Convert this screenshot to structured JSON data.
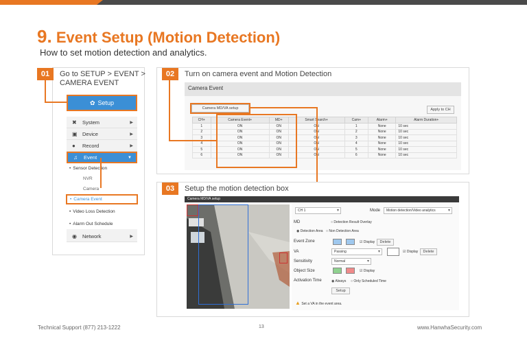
{
  "header": {
    "number": "9.",
    "title": "Event Setup (Motion Detection)",
    "subtitle": "How to set motion detection and analytics."
  },
  "steps": [
    {
      "num": "01",
      "text_line1": "Go to SETUP > EVENT >",
      "text_line2": "CAMERA EVENT"
    },
    {
      "num": "02",
      "text": "Turn on camera event and Motion Detection"
    },
    {
      "num": "03",
      "text": "Setup the motion detection box"
    }
  ],
  "menu": {
    "setup_label": "Setup",
    "items": [
      {
        "label": "System",
        "icon": "wrench-icon"
      },
      {
        "label": "Device",
        "icon": "camera-icon"
      },
      {
        "label": "Record",
        "icon": "record-icon"
      }
    ],
    "event_label": "Event",
    "sub": {
      "sensor_detection": "Sensor Detection",
      "nvr": "NVR",
      "camera": "Camera",
      "camera_event": "Camera Event",
      "video_loss": "Video Loss Detection",
      "alarm_out": "Alarm Out Schedule"
    },
    "network_label": "Network"
  },
  "camera_event": {
    "panel_title": "Camera Event",
    "setup_button": "Camera MD/VA setup",
    "apply_button": "Apply to CH",
    "columns": [
      "CH+",
      "Camera Event+",
      "MD+",
      "Smart Search+",
      "Cam+",
      "Alarm+",
      "Alarm Duration+"
    ],
    "rows": [
      [
        "1",
        "ON",
        "ON",
        "ON",
        "1",
        "None",
        "10 sec"
      ],
      [
        "2",
        "ON",
        "ON",
        "ON",
        "2",
        "None",
        "10 sec"
      ],
      [
        "3",
        "ON",
        "ON",
        "ON",
        "3",
        "None",
        "10 sec"
      ],
      [
        "4",
        "ON",
        "ON",
        "ON",
        "4",
        "None",
        "10 sec"
      ],
      [
        "5",
        "ON",
        "ON",
        "ON",
        "5",
        "None",
        "10 sec"
      ],
      [
        "6",
        "ON",
        "ON",
        "ON",
        "6",
        "None",
        "10 sec"
      ]
    ]
  },
  "md_setup": {
    "header": "Camera MD/VA setup",
    "channel": "CH 1",
    "mode_label": "Mode",
    "mode_value": "Motion detection/Video analytics",
    "md_label": "MD",
    "detection_result_overlay": "Detection Result Overlay",
    "detection_area": "Detection Area",
    "non_detection_area": "Non Detection Area",
    "event_zone_label": "Event Zone",
    "display_label": "Display",
    "delete_label": "Delete",
    "va_label": "VA",
    "va_value": "Passing",
    "sensitivity_label": "Sensitivity",
    "sensitivity_value": "Normal",
    "object_size_label": "Object Size",
    "activation_time_label": "Activation Time",
    "always": "Always",
    "only_scheduled": "Only Scheduled Time",
    "setup_button": "Setup",
    "warning": "Set a VA in the event area."
  },
  "footer": {
    "support": "Technical Support (877) 213-1222",
    "page": "13",
    "website": "www.HanwhaSecurity.com"
  },
  "colors": {
    "accent": "#e87722",
    "menu_blue": "#3b8fd6",
    "dark_bar": "#4a4a4a"
  }
}
